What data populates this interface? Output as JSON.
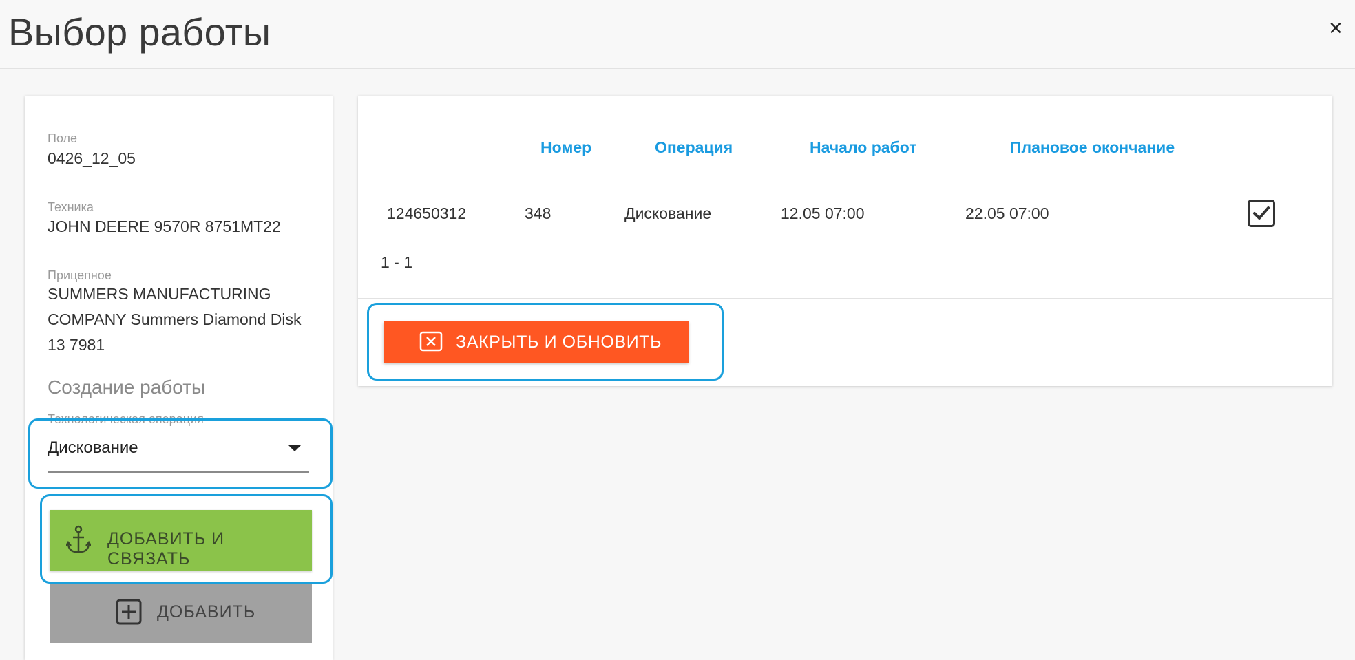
{
  "header": {
    "title": "Выбор работы",
    "close_label": "×"
  },
  "left_panel": {
    "field_label": "Поле",
    "field_value": "0426_12_05",
    "machine_label": "Техника",
    "machine_value": "JOHN DEERE 9570R 8751MT22",
    "implement_label": "Прицепное",
    "implement_value": "SUMMERS MANUFACTURING COMPANY Summers Diamond Disk 13 7981",
    "create_title": "Создание работы",
    "operation_label": "Технологическая операция",
    "operation_value": "Дискование",
    "add_link_button": "ДОБАВИТЬ И СВЯЗАТЬ",
    "add_button": "ДОБАВИТЬ"
  },
  "table": {
    "columns": [
      "Номер",
      "Операция",
      "Начало работ",
      "Плановое окончание"
    ],
    "rows": [
      {
        "id": "124650312",
        "number": "348",
        "operation": "Дискование",
        "start": "12.05 07:00",
        "planned_end": "22.05 07:00",
        "checked": true
      }
    ],
    "pagination": "1 - 1"
  },
  "actions": {
    "close_refresh_button": "ЗАКРЫТЬ И ОБНОВИТЬ"
  },
  "colors": {
    "accent": "#1a9be0",
    "highlight": "#1aa0dc",
    "green_button": "#8bc34a",
    "orange_button": "#ff5722",
    "grey_button": "#a1a1a1"
  }
}
